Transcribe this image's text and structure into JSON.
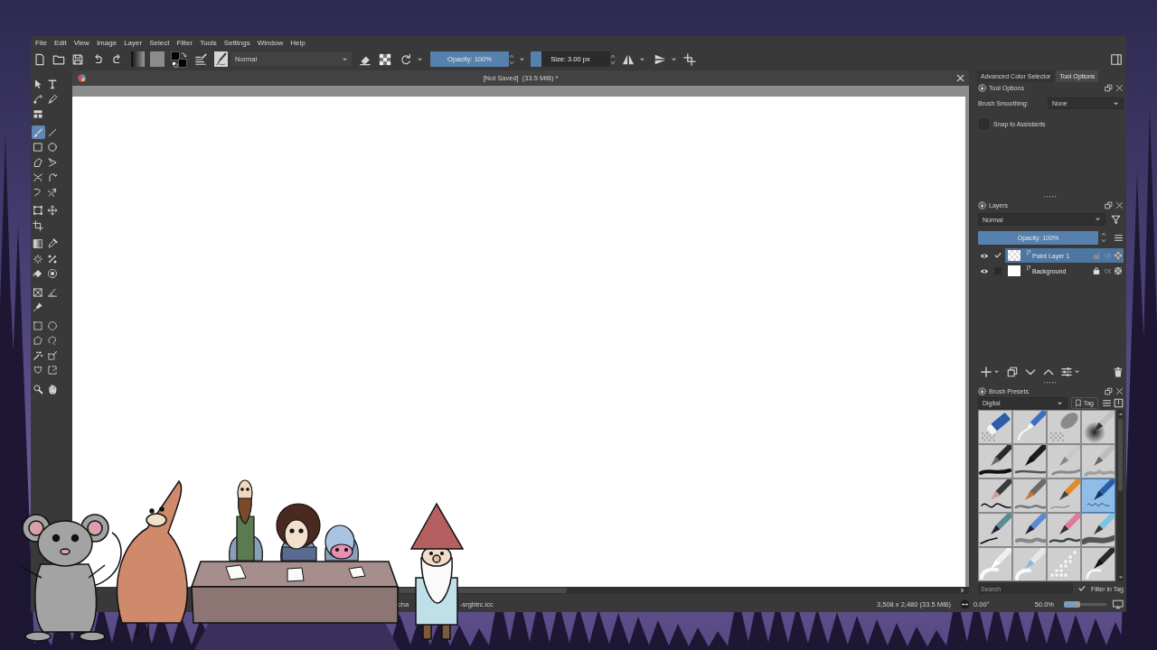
{
  "menu": [
    "File",
    "Edit",
    "View",
    "Image",
    "Layer",
    "Select",
    "Filter",
    "Tools",
    "Settings",
    "Window",
    "Help"
  ],
  "toolbar": {
    "blend_mode": "Normal",
    "opacity": {
      "label": "Opacity: 100%",
      "level": 1
    },
    "size": {
      "label": "Size: 3.00 px",
      "level": 0.14
    }
  },
  "document": {
    "title": "[Not Saved]  (33.5 MiB) *"
  },
  "toolbox": [
    [
      {
        "kind": "pointer",
        "selected": false
      },
      {
        "kind": "text",
        "selected": false
      },
      {
        "kind": "nodes",
        "selected": false
      },
      {
        "kind": "calligraphy",
        "selected": false
      },
      {
        "kind": "layout",
        "selected": false
      }
    ],
    [
      {
        "kind": "brush",
        "selected": true
      },
      {
        "kind": "line",
        "selected": false
      },
      {
        "kind": "rectangle",
        "selected": false
      },
      {
        "kind": "ellipse",
        "selected": false
      },
      {
        "kind": "polygon",
        "selected": false
      },
      {
        "kind": "polyline",
        "selected": false
      },
      {
        "kind": "bezier",
        "selected": false
      },
      {
        "kind": "path",
        "selected": false
      },
      {
        "kind": "dynamic",
        "selected": false
      },
      {
        "kind": "multibrush",
        "selected": false
      }
    ],
    [
      {
        "kind": "transform",
        "selected": false
      },
      {
        "kind": "move",
        "selected": false
      },
      {
        "kind": "crop",
        "selected": false
      }
    ],
    [
      {
        "kind": "gradient",
        "selected": false
      },
      {
        "kind": "picker",
        "selected": false
      },
      {
        "kind": "colorize",
        "selected": false
      },
      {
        "kind": "patch",
        "selected": false
      },
      {
        "kind": "fill",
        "selected": false
      },
      {
        "kind": "enclose",
        "selected": false
      }
    ],
    [
      {
        "kind": "assistant",
        "selected": false
      },
      {
        "kind": "measure",
        "selected": false
      },
      {
        "kind": "pin",
        "selected": false
      }
    ],
    [
      {
        "kind": "rectselect",
        "selected": false
      },
      {
        "kind": "ellipseselect",
        "selected": false
      },
      {
        "kind": "polyselect",
        "selected": false
      },
      {
        "kind": "lassoselect",
        "selected": false
      },
      {
        "kind": "wandselect",
        "selected": false
      },
      {
        "kind": "similarselect",
        "selected": false
      },
      {
        "kind": "bezierselect",
        "selected": false
      },
      {
        "kind": "magneticselect",
        "selected": false
      }
    ],
    [
      {
        "kind": "zoom",
        "selected": false
      },
      {
        "kind": "hand",
        "selected": false
      }
    ]
  ],
  "dockers": {
    "tabs": [
      {
        "label": "Advanced Color Selector",
        "selected": false
      },
      {
        "label": "Tool Options",
        "selected": true
      }
    ],
    "tool_options": {
      "title": "Tool Options",
      "brush_smoothing": {
        "label": "Brush Smoothing:",
        "value": "None"
      },
      "snap_to_assistants": {
        "label": "Snap to Assistants",
        "checked": false
      }
    },
    "layers": {
      "title": "Layers",
      "blend_mode": "Normal",
      "opacity": {
        "label": "Opacity: 100%",
        "level": 1
      },
      "items": [
        {
          "name": "Paint Layer 1",
          "visible": true,
          "checked": true,
          "transparent": true,
          "locked": false,
          "selected": true
        },
        {
          "name": "Background",
          "visible": true,
          "checked": false,
          "transparent": false,
          "locked": true,
          "selected": false
        }
      ]
    },
    "brush_presets": {
      "title": "Brush Presets",
      "tag": "Digital",
      "tag_button": "Tag",
      "presets": [
        {
          "kind": "eraser",
          "selected": false
        },
        {
          "kind": "stickeraser",
          "selected": false
        },
        {
          "kind": "softeraser",
          "selected": false
        },
        {
          "kind": "airbrush",
          "selected": false
        },
        {
          "kind": "marker",
          "selected": false
        },
        {
          "kind": "inkbrush",
          "selected": false
        },
        {
          "kind": "pencil",
          "selected": false
        },
        {
          "kind": "graphite",
          "selected": false
        },
        {
          "kind": "brush",
          "selected": false
        },
        {
          "kind": "paintbrush",
          "selected": false
        },
        {
          "kind": "fineliner",
          "selected": false
        },
        {
          "kind": "ballpen",
          "selected": true
        },
        {
          "kind": "inkpen",
          "selected": false
        },
        {
          "kind": "texture",
          "selected": false
        },
        {
          "kind": "chalk",
          "selected": false
        },
        {
          "kind": "wetbrush",
          "selected": false
        },
        {
          "kind": "blender",
          "selected": false
        },
        {
          "kind": "smudge",
          "selected": false
        },
        {
          "kind": "pixel",
          "selected": false
        },
        {
          "kind": "blur",
          "selected": false
        }
      ],
      "search": {
        "placeholder": "Search"
      },
      "filter_in_tag": {
        "label": "Filter in Tag",
        "checked": true
      }
    }
  },
  "status_bar": {
    "profile_fragments": [
      "cha",
      "-srgbtrc.icc"
    ],
    "dimensions": "3,508 x 2,480 (33.5 MiB)",
    "rotation": "0.00°",
    "zoom": "50.0%",
    "zoom_slider": {
      "level": 0.38
    }
  }
}
